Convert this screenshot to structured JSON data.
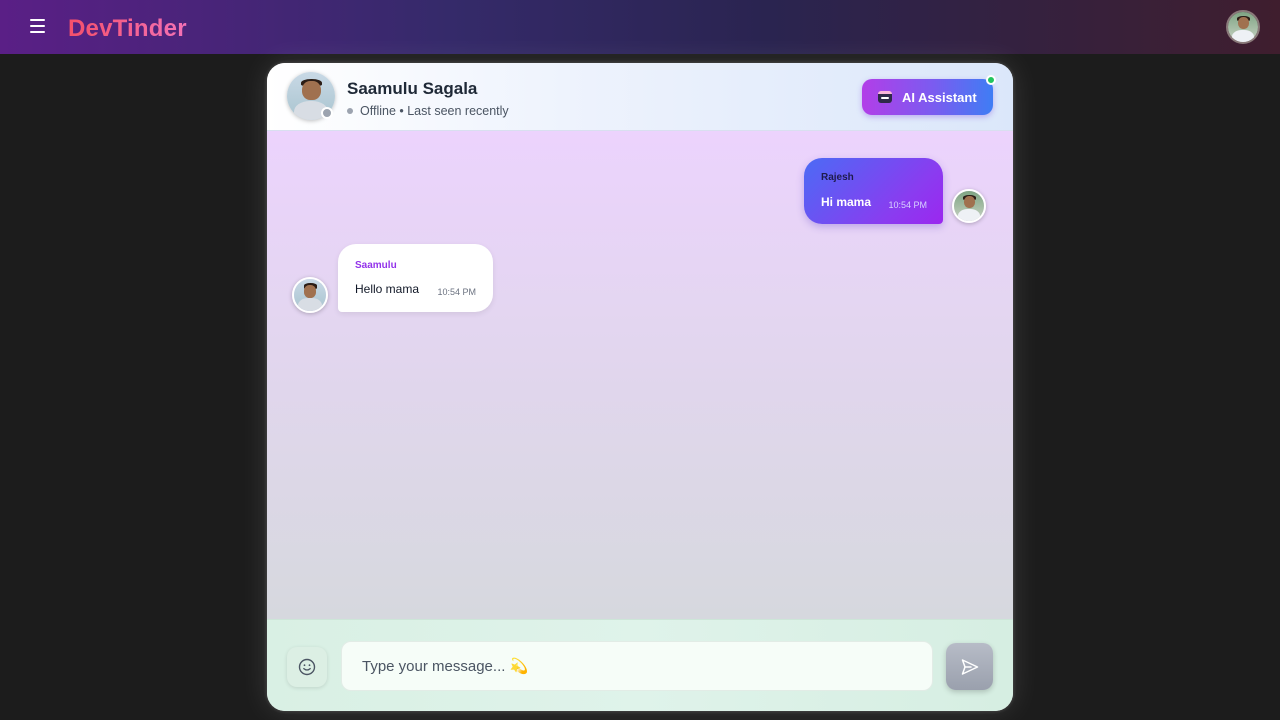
{
  "navbar": {
    "brand": "DevTinder",
    "menu_icon": "hamburger-menu-icon",
    "avatar_icon": "user-avatar-icon"
  },
  "chat": {
    "contact_name": "Saamulu Sagala",
    "contact_status": "Offline • Last seen recently",
    "ai_button_label": "AI Assistant",
    "messages": [
      {
        "sender": "Rajesh",
        "text": "Hi mama",
        "time": "10:54 PM",
        "direction": "outgoing"
      },
      {
        "sender": "Saamulu",
        "text": "Hello mama",
        "time": "10:54 PM",
        "direction": "incoming"
      }
    ],
    "input_placeholder": "Type your message... 💫"
  },
  "colors": {
    "brand": "#f4506a",
    "accent_purple": "#9333ea",
    "offline": "#9ca3af",
    "online": "#22c55e"
  }
}
